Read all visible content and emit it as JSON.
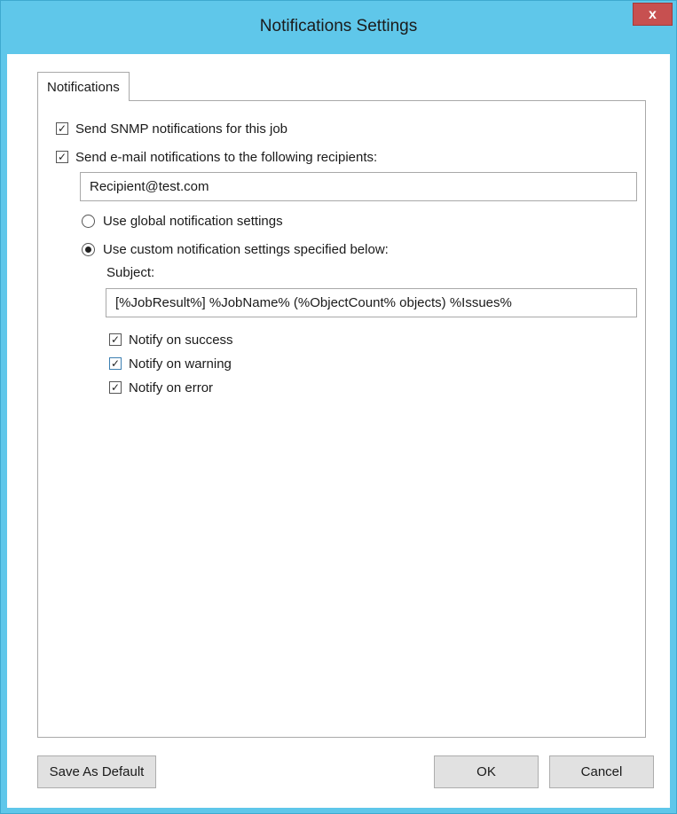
{
  "window": {
    "title": "Notifications Settings",
    "close_glyph": "x"
  },
  "tabs": [
    {
      "label": "Notifications"
    }
  ],
  "options": {
    "snmp": {
      "label": "Send SNMP notifications for this job",
      "checked": true
    },
    "email": {
      "label": "Send e-mail notifications to the following recipients:",
      "checked": true
    },
    "recipients_value": "Recipient@test.com",
    "use_global": {
      "label": "Use global notification settings",
      "selected": false
    },
    "use_custom": {
      "label": "Use custom notification settings specified below:",
      "selected": true
    },
    "subject_label": "Subject:",
    "subject_value": "[%JobResult%] %JobName% (%ObjectCount% objects) %Issues%",
    "notify_success": {
      "label": "Notify on success",
      "checked": true
    },
    "notify_warning": {
      "label": "Notify on warning",
      "checked": true
    },
    "notify_error": {
      "label": "Notify on error",
      "checked": true
    }
  },
  "buttons": {
    "save_default": "Save As Default",
    "ok": "OK",
    "cancel": "Cancel"
  },
  "icons": {
    "checkmark": "✓",
    "close": "x"
  },
  "colors": {
    "titlebar": "#5fc7ea",
    "close_button": "#c75050",
    "button_face": "#e1e1e1"
  }
}
